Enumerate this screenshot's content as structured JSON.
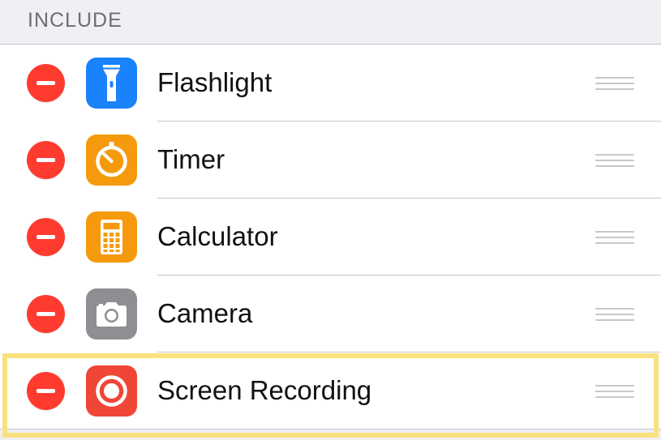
{
  "section": {
    "title": "INCLUDE"
  },
  "items": [
    {
      "label": "Flashlight",
      "icon": "flashlight-icon",
      "color": "#1a82fb"
    },
    {
      "label": "Timer",
      "icon": "timer-icon",
      "color": "#f59a0c"
    },
    {
      "label": "Calculator",
      "icon": "calculator-icon",
      "color": "#f59a0c"
    },
    {
      "label": "Camera",
      "icon": "camera-icon",
      "color": "#8e8e93"
    },
    {
      "label": "Screen Recording",
      "icon": "screen-recording-icon",
      "color": "#f04637"
    }
  ],
  "colors": {
    "delete": "#ff3b30",
    "highlight": "#f9e27d",
    "background": "#efeff4"
  }
}
